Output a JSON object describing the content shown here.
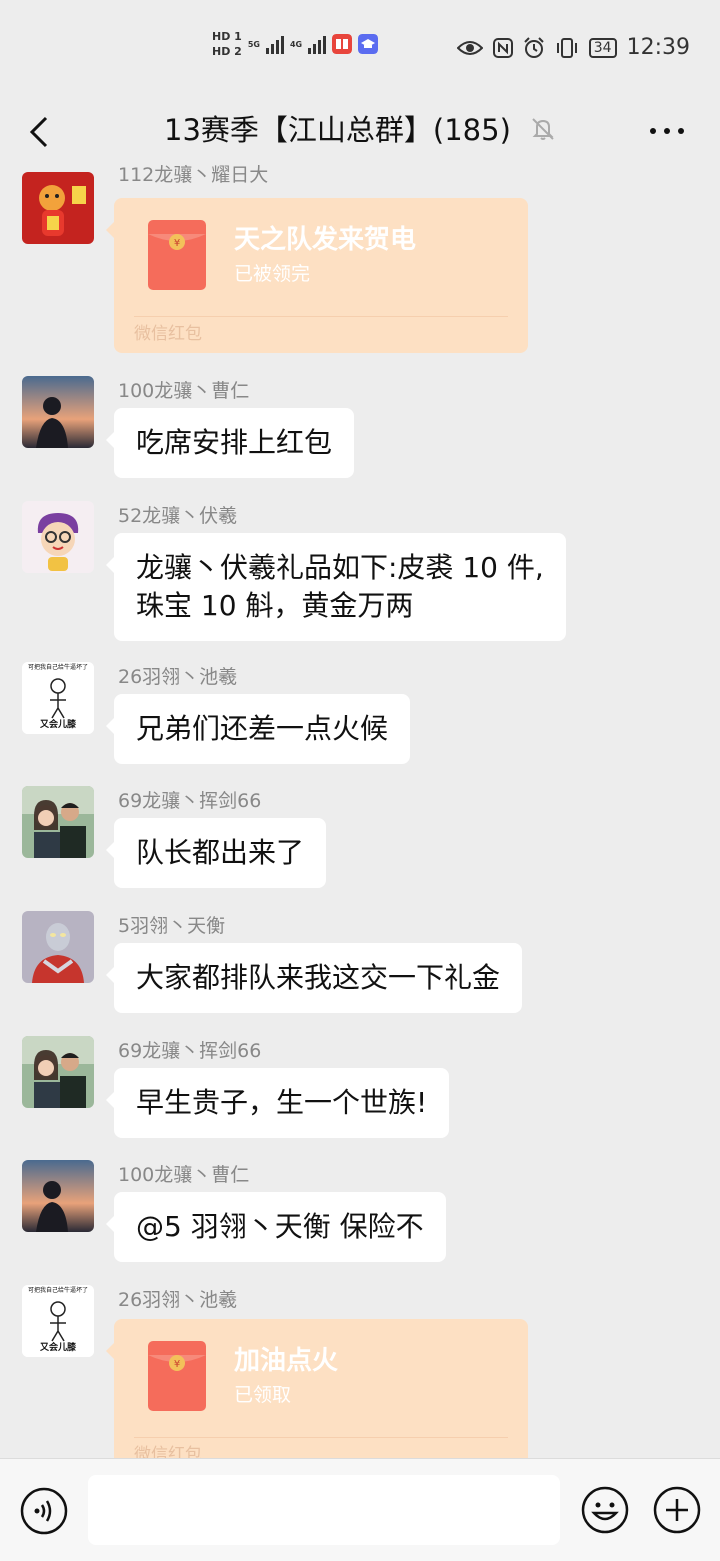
{
  "status_bar": {
    "hd1": "HD 1",
    "hd2": "HD 2",
    "net1": "5G",
    "net2": "4G",
    "battery": "34",
    "time": "12:39",
    "icons": [
      "eye-icon",
      "nfc-icon",
      "alarm-icon",
      "vibrate-icon"
    ]
  },
  "header": {
    "title": "13赛季【江山总群】(185)"
  },
  "messages": [
    {
      "sender": "112龙骧丶耀日大",
      "type": "redpacket",
      "title": "天之队发来贺电",
      "subtitle": "已被领完",
      "footer": "微信红包"
    },
    {
      "sender": "100龙骧丶曹仁",
      "type": "text",
      "text": "吃席安排上红包"
    },
    {
      "sender": "52龙骧丶伏羲",
      "type": "text",
      "line1": "龙骧丶伏羲礼品如下:皮裘 10 件,",
      "line2": "珠宝 10 斛，黄金万两"
    },
    {
      "sender": "26羽翎丶池羲",
      "type": "text",
      "text": "兄弟们还差一点火候",
      "avatar_caption_top": "可把我自己给牛逼坏了",
      "avatar_caption_bottom": "又会儿膝"
    },
    {
      "sender": "69龙骧丶挥剑66",
      "type": "text",
      "text": "队长都出来了"
    },
    {
      "sender": "5羽翎丶天衡",
      "type": "text",
      "text": "大家都排队来我这交一下礼金"
    },
    {
      "sender": "69龙骧丶挥剑66",
      "type": "text",
      "text": "早生贵子，生一个世族!"
    },
    {
      "sender": "100龙骧丶曹仁",
      "type": "text",
      "text": "@5 羽翎丶天衡  保险不"
    },
    {
      "sender": "26羽翎丶池羲",
      "type": "redpacket",
      "title": "加油点火",
      "subtitle": "已领取",
      "footer": "微信红包",
      "avatar_caption_top": "可把我自己给牛逼坏了",
      "avatar_caption_bottom": "又会儿膝"
    }
  ],
  "input_bar": {
    "icons": [
      "voice-icon",
      "emoji-icon",
      "plus-icon"
    ]
  },
  "colors": {
    "background": "#ededed",
    "bubble": "#ffffff",
    "redpacket": "#fde0c3",
    "redpacket_icon": "#f56c5b"
  }
}
